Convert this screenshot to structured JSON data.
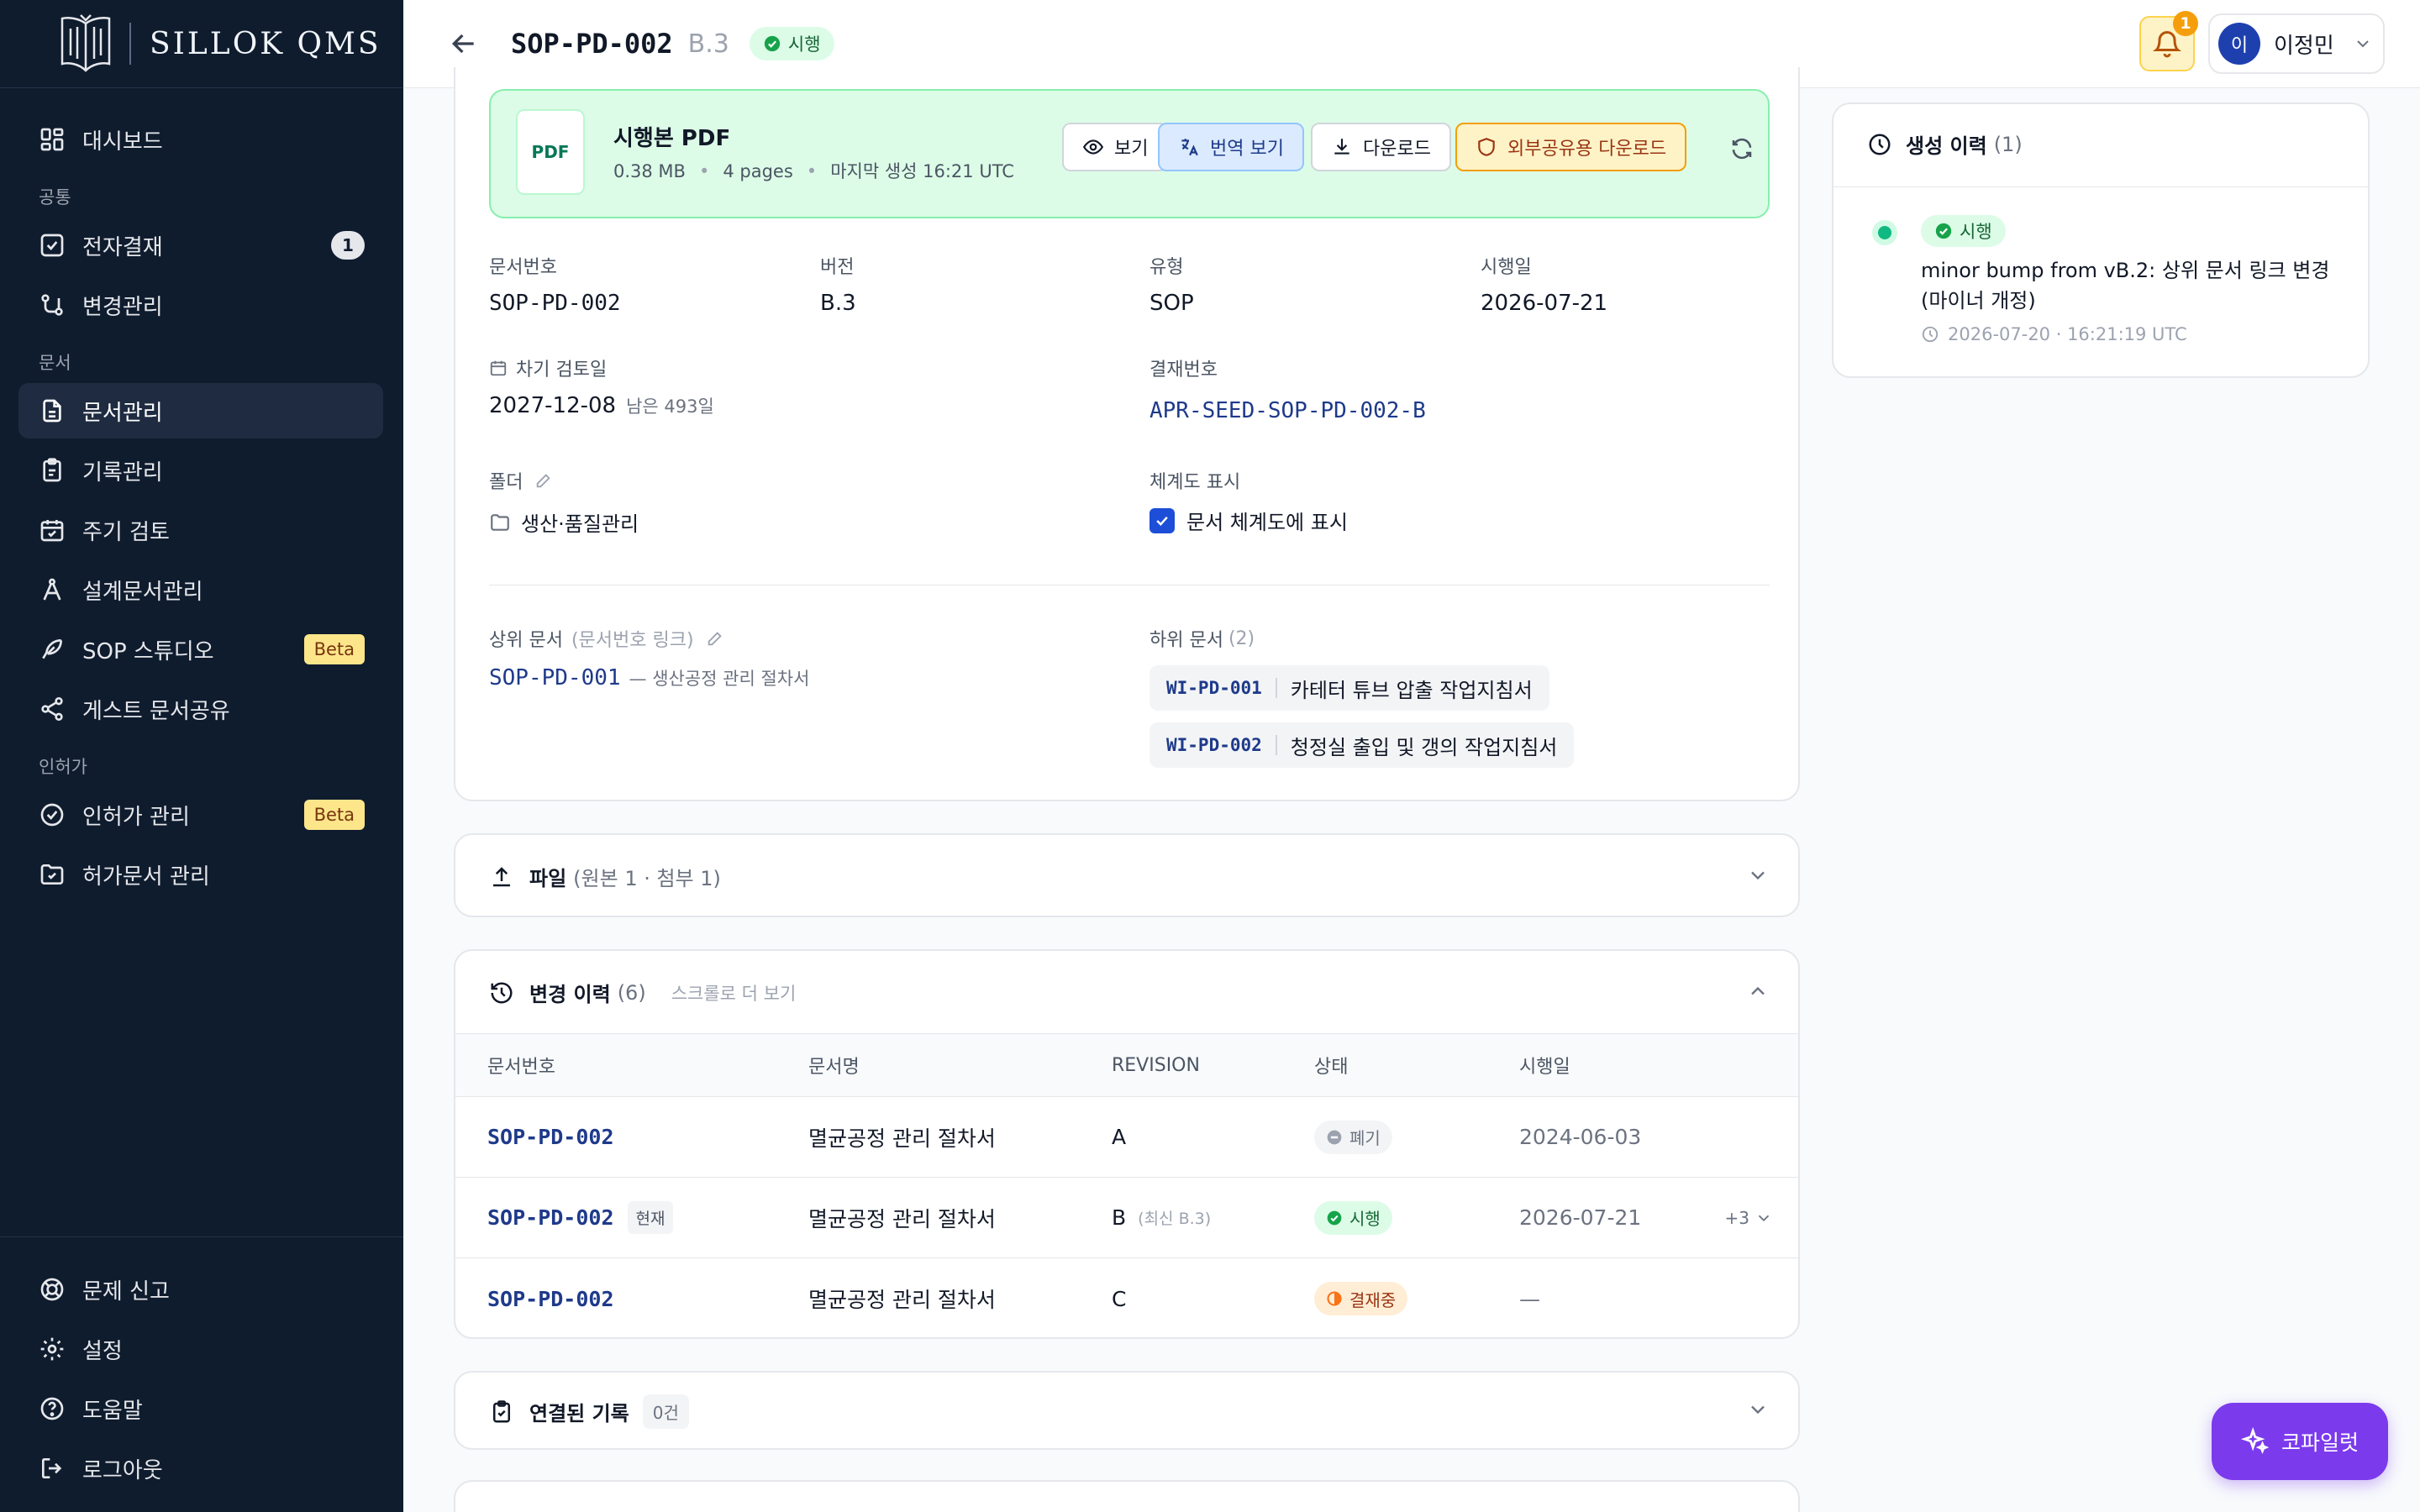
{
  "sidebar": {
    "brand": "SILLOK QMS",
    "dashboard": "대시보드",
    "section_common": "공통",
    "approval": "전자결재",
    "approval_count": "1",
    "change_mgmt": "변경관리",
    "section_docs": "문서",
    "doc_mgmt": "문서관리",
    "record_mgmt": "기록관리",
    "periodic_review": "주기 검토",
    "design_docs": "설계문서관리",
    "sop_studio": "SOP 스튜디오",
    "sop_studio_badge": "Beta",
    "guest_share": "게스트 문서공유",
    "section_license": "인허가",
    "license_mgmt": "인허가 관리",
    "license_badge": "Beta",
    "permit_docs": "허가문서 관리",
    "report_issue": "문제 신고",
    "settings": "설정",
    "help": "도움말",
    "logout": "로그아웃"
  },
  "header": {
    "doc_no": "SOP-PD-002",
    "revision": "B.3",
    "status": "시행",
    "notification_count": "1",
    "user_initial": "이",
    "user_name": "이정민"
  },
  "pdf": {
    "icon_label": "PDF",
    "title": "시행본 PDF",
    "size": "0.38 MB",
    "pages": "4 pages",
    "generated": "마지막 생성 16:21 UTC",
    "view": "보기",
    "translate": "번역 보기",
    "download": "다운로드",
    "external_download": "외부공유용 다운로드"
  },
  "fields": {
    "doc_no_label": "문서번호",
    "doc_no": "SOP-PD-002",
    "version_label": "버전",
    "version": "B.3",
    "type_label": "유형",
    "type": "SOP",
    "effective_label": "시행일",
    "effective": "2026-07-21",
    "next_review_label": "차기 검토일",
    "next_review": "2027-12-08",
    "remaining": "남은 493일",
    "approval_no_label": "결재번호",
    "approval_no": "APR-SEED-SOP-PD-002-B",
    "folder_label": "폴더",
    "folder": "생산·품질관리",
    "hierarchy_label": "체계도 표시",
    "hierarchy_check": "문서 체계도에 표시",
    "parent_label": "상위 문서",
    "parent_sub": "(문서번호 링크)",
    "parent_no": "SOP-PD-001",
    "parent_title": "— 생산공정 관리 절차서",
    "children_label": "하위 문서",
    "children_count": "(2)",
    "children": [
      {
        "no": "WI-PD-001",
        "title": "카테터 튜브 압출 작업지침서"
      },
      {
        "no": "WI-PD-002",
        "title": "청정실 출입 및 갱의 작업지침서"
      }
    ]
  },
  "files": {
    "title": "파일",
    "summary": "(원본 1 · 첨부 1)"
  },
  "history": {
    "title": "변경 이력",
    "count": "(6)",
    "hint": "스크롤로 더 보기",
    "columns": [
      "문서번호",
      "문서명",
      "REVISION",
      "상태",
      "시행일"
    ],
    "rows": [
      {
        "no": "SOP-PD-002",
        "current": "",
        "name": "멸균공정 관리 절차서",
        "rev": "A",
        "rev_note": "",
        "status": "폐기",
        "date": "2024-06-03",
        "more": ""
      },
      {
        "no": "SOP-PD-002",
        "current": "현재",
        "name": "멸균공정 관리 절차서",
        "rev": "B",
        "rev_note": "(최신 B.3)",
        "status": "시행",
        "date": "2026-07-21",
        "more": "+3"
      },
      {
        "no": "SOP-PD-002",
        "current": "",
        "name": "멸균공정 관리 절차서",
        "rev": "C",
        "rev_note": "",
        "status": "결재중",
        "date": "—",
        "more": ""
      }
    ]
  },
  "linked": {
    "title": "연결된 기록",
    "count": "0건"
  },
  "generation": {
    "title": "생성 이력",
    "count": "(1)",
    "status": "시행",
    "desc": "minor bump from vB.2: 상위 문서 링크 변경 (마이너 개정)",
    "time": "2026-07-20 · 16:21:19 UTC"
  },
  "copilot": {
    "label": "코파일럿"
  },
  "colors": {
    "sidebar_bg": "#0f1c2e",
    "accent_blue": "#1e3a8a",
    "status_green": "#166534",
    "copilot": "#7c3aed"
  }
}
